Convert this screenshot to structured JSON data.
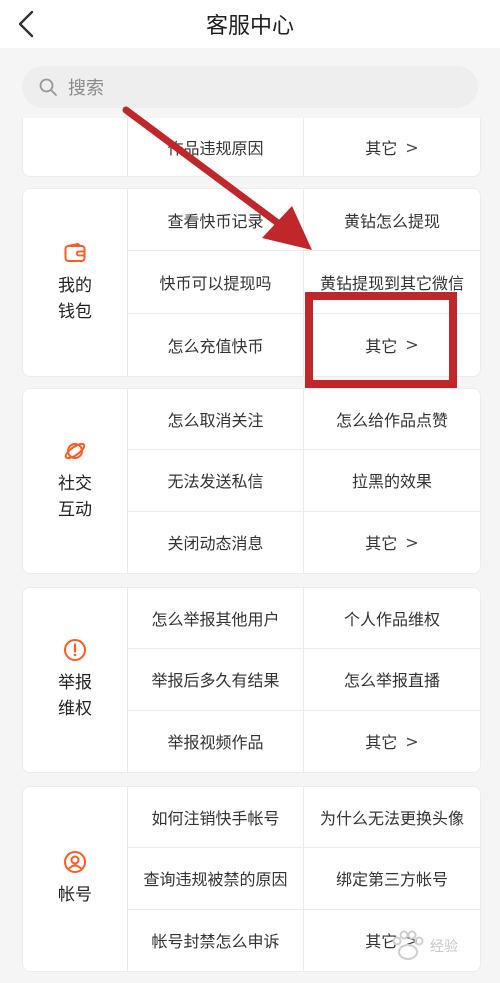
{
  "header": {
    "title": "客服中心"
  },
  "search": {
    "placeholder": "搜索"
  },
  "partial_card": {
    "left": "作品违规原因",
    "right": "其它"
  },
  "categories": [
    {
      "label": "我的钱包",
      "icon": "wallet-icon",
      "items": [
        "查看快币记录",
        "黄钻怎么提现",
        "快币可以提现吗",
        "黄钻提现到其它微信",
        "怎么充值快币",
        "其它"
      ]
    },
    {
      "label": "社交互动",
      "icon": "planet-icon",
      "items": [
        "怎么取消关注",
        "怎么给作品点赞",
        "无法发送私信",
        "拉黑的效果",
        "关闭动态消息",
        "其它"
      ]
    },
    {
      "label": "举报维权",
      "icon": "alert-icon",
      "items": [
        "怎么举报其他用户",
        "个人作品维权",
        "举报后多久有结果",
        "怎么举报直播",
        "举报视频作品",
        "其它"
      ]
    },
    {
      "label": "帐号",
      "icon": "user-icon",
      "items": [
        "如何注销快手帐号",
        "为什么无法更换头像",
        "查询违规被禁的原因",
        "绑定第三方帐号",
        "帐号封禁怎么申诉",
        "其它"
      ]
    }
  ],
  "watermark": {
    "text": "经验"
  },
  "colors": {
    "accent": "#ff5a1f",
    "annotation": "#c0262a"
  }
}
